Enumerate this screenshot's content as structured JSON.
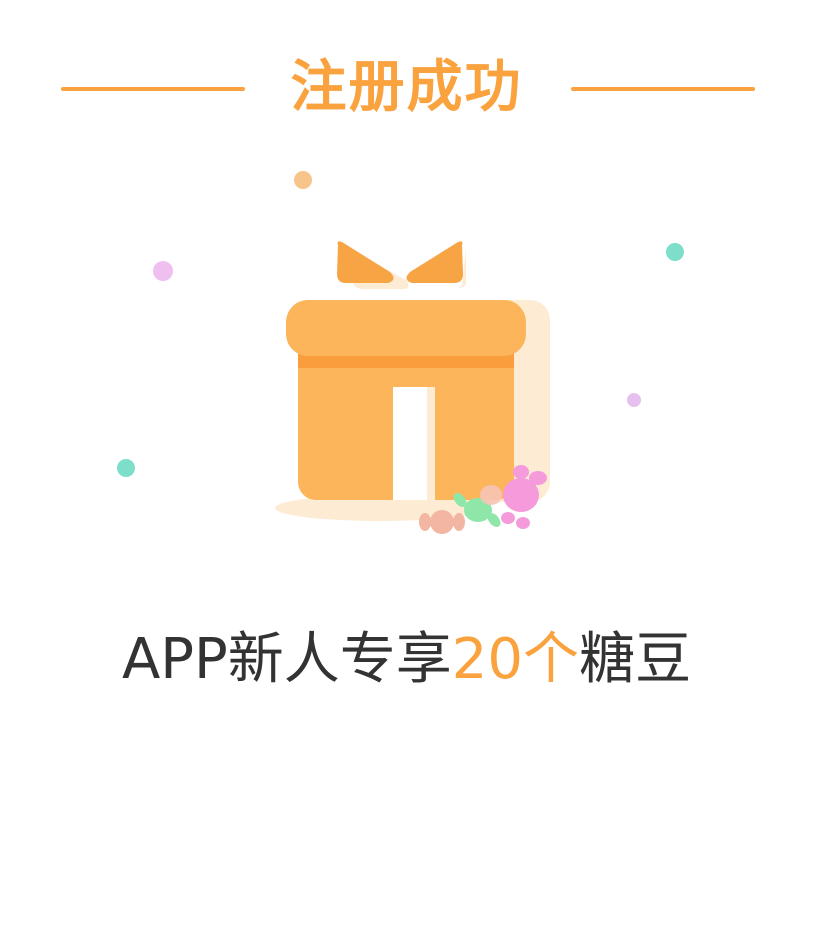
{
  "colors": {
    "accent": "#f9a23e",
    "text": "#333333",
    "gift_body": "#fdb55c",
    "gift_band": "#fa9d3c",
    "gift_shadow": "#fdebd3",
    "bow": "#f7a544",
    "confetti_orange": "#f7c58a",
    "confetti_pink": "#efc0ef",
    "confetti_teal": "#7ddfca",
    "candy_pink": "#f59bdc",
    "candy_green": "#8fe6a9",
    "candy_peach": "#f2b6a3"
  },
  "header": {
    "title": "注册成功"
  },
  "illustration": {
    "icon": "gift-box-icon",
    "decorations": [
      "confetti-dot",
      "candy-icon"
    ]
  },
  "promo": {
    "prefix": "APP新人专享",
    "amount": "20个",
    "suffix": "糖豆"
  }
}
